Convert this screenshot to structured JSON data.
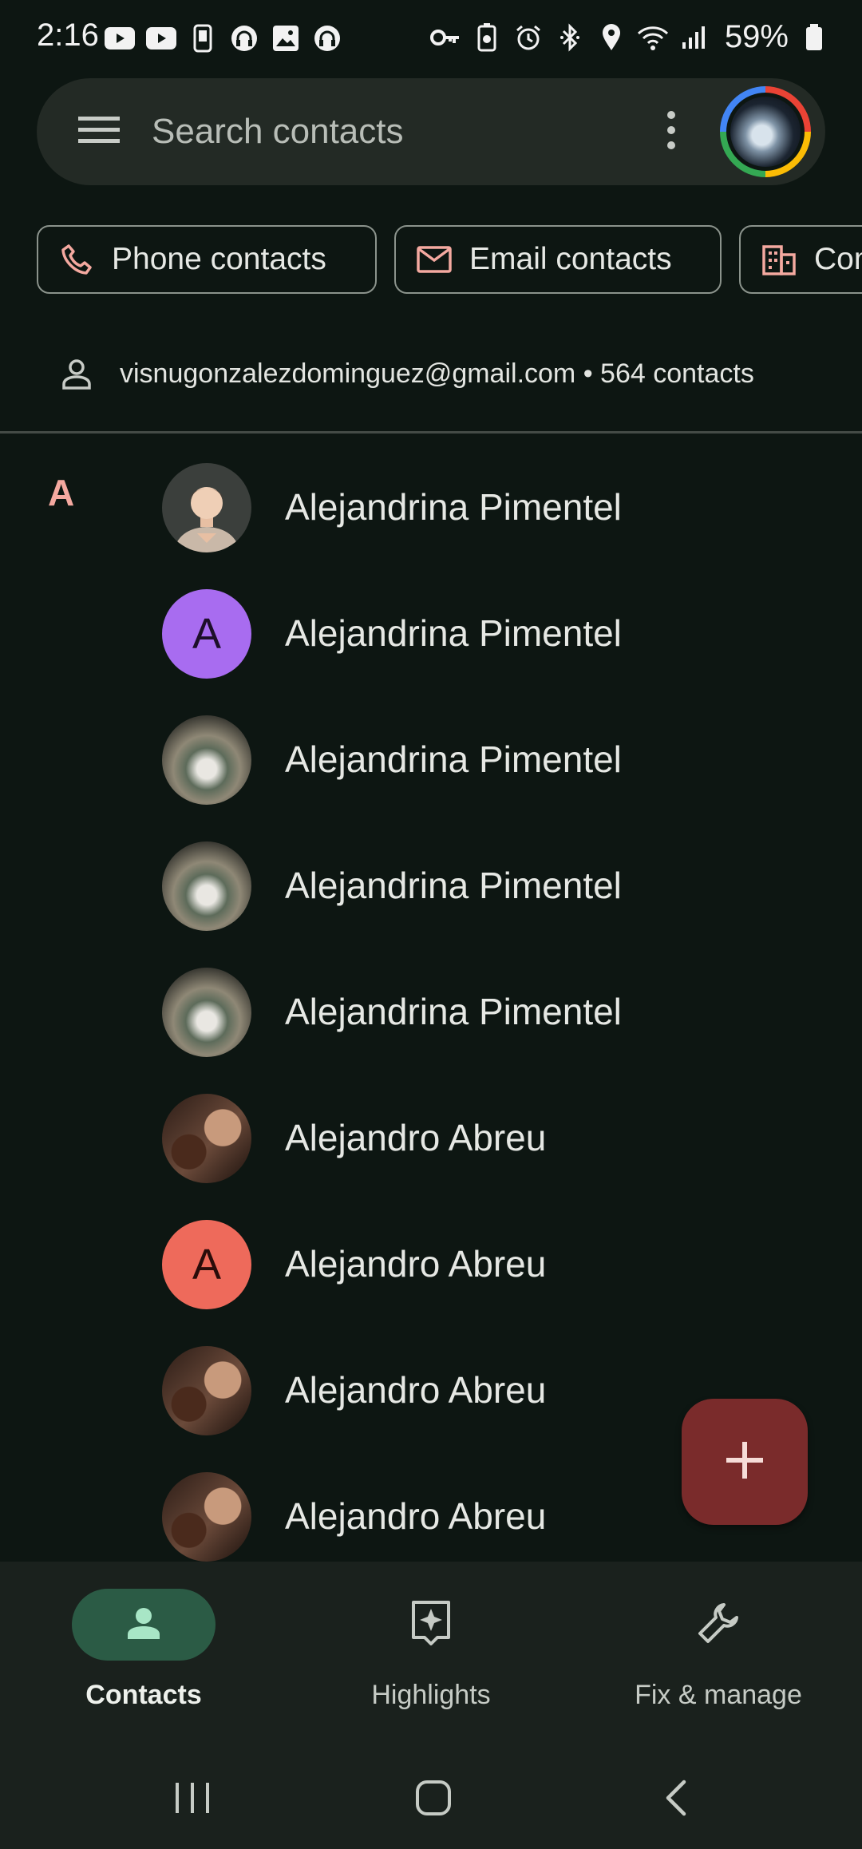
{
  "status_bar": {
    "time": "2:16",
    "notification_icons": [
      "youtube-icon",
      "youtube-icon",
      "phone-icon",
      "headset-icon",
      "gallery-icon",
      "headset-icon"
    ],
    "system_icons": [
      "key-icon",
      "battery-saver-icon",
      "alarm-icon",
      "bluetooth-icon",
      "location-icon",
      "wifi-icon",
      "signal-icon"
    ],
    "battery": "59%"
  },
  "search": {
    "placeholder": "Search contacts"
  },
  "filter_chips": [
    {
      "label": "Phone contacts",
      "icon": "phone-icon"
    },
    {
      "label": "Email contacts",
      "icon": "mail-icon"
    },
    {
      "label": "Company",
      "icon": "building-icon"
    }
  ],
  "account": {
    "summary": "visnugonzalezdominguez@gmail.com • 564 contacts"
  },
  "section_letter": "A",
  "contacts": [
    {
      "name": "Alejandrina Pimentel",
      "avatar": "memoji",
      "initial": ""
    },
    {
      "name": "Alejandrina Pimentel",
      "avatar": "letter-purple",
      "initial": "A"
    },
    {
      "name": "Alejandrina Pimentel",
      "avatar": "photo",
      "initial": ""
    },
    {
      "name": "Alejandrina Pimentel",
      "avatar": "photo",
      "initial": ""
    },
    {
      "name": "Alejandrina Pimentel",
      "avatar": "photo",
      "initial": ""
    },
    {
      "name": "Alejandro Abreu",
      "avatar": "photo",
      "initial": ""
    },
    {
      "name": "Alejandro Abreu",
      "avatar": "letter-red",
      "initial": "A"
    },
    {
      "name": "Alejandro Abreu",
      "avatar": "photo",
      "initial": ""
    },
    {
      "name": "Alejandro Abreu",
      "avatar": "photo",
      "initial": ""
    }
  ],
  "bottom_nav": [
    {
      "label": "Contacts",
      "icon": "person-icon",
      "active": true
    },
    {
      "label": "Highlights",
      "icon": "highlights-icon",
      "active": false
    },
    {
      "label": "Fix & manage",
      "icon": "wrench-icon",
      "active": false
    }
  ],
  "colors": {
    "background": "#0d1612",
    "section_letter": "#f4a9a0",
    "fab": "#7a2b2b",
    "active_nav_pill": "#2b5b45"
  }
}
